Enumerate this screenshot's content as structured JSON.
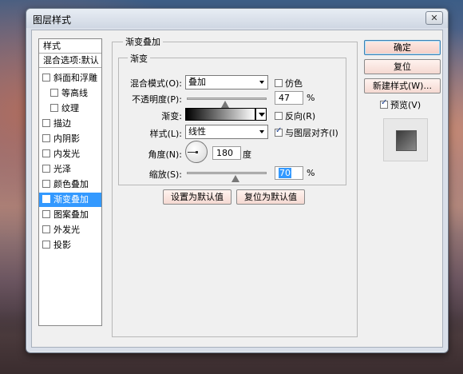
{
  "window": {
    "title": "图层样式",
    "close_label": "✕"
  },
  "sidebar": {
    "header": "样式",
    "subheader": "混合选项:默认",
    "items": [
      {
        "label": "斜面和浮雕",
        "checked": false,
        "sub": false
      },
      {
        "label": "等高线",
        "checked": false,
        "sub": true
      },
      {
        "label": "纹理",
        "checked": false,
        "sub": true
      },
      {
        "label": "描边",
        "checked": false,
        "sub": false
      },
      {
        "label": "内阴影",
        "checked": false,
        "sub": false
      },
      {
        "label": "内发光",
        "checked": false,
        "sub": false
      },
      {
        "label": "光泽",
        "checked": false,
        "sub": false
      },
      {
        "label": "颜色叠加",
        "checked": false,
        "sub": false
      },
      {
        "label": "渐变叠加",
        "checked": true,
        "sub": false,
        "selected": true
      },
      {
        "label": "图案叠加",
        "checked": false,
        "sub": false
      },
      {
        "label": "外发光",
        "checked": false,
        "sub": false
      },
      {
        "label": "投影",
        "checked": false,
        "sub": false
      }
    ]
  },
  "panel": {
    "section_title": "渐变叠加",
    "group_title": "渐变",
    "blend_mode_label": "混合模式(O):",
    "blend_mode_value": "叠加",
    "dither_label": "仿色",
    "opacity_label": "不透明度(P):",
    "opacity_value": "47",
    "opacity_unit": "%",
    "gradient_label": "渐变:",
    "reverse_label": "反向(R)",
    "style_label": "样式(L):",
    "style_value": "线性",
    "align_label": "与图层对齐(I)",
    "angle_label": "角度(N):",
    "angle_value": "180",
    "angle_unit": "度",
    "scale_label": "缩放(S):",
    "scale_value": "70",
    "scale_unit": "%",
    "make_default_label": "设置为默认值",
    "reset_default_label": "复位为默认值",
    "dither_checked": false,
    "reverse_checked": false,
    "align_checked": true,
    "opacity_level": 47,
    "scale_level": 70
  },
  "buttons": {
    "ok": "确定",
    "reset": "复位",
    "new_style": "新建样式(W)...",
    "preview_label": "预览(V)",
    "preview_checked": true
  }
}
